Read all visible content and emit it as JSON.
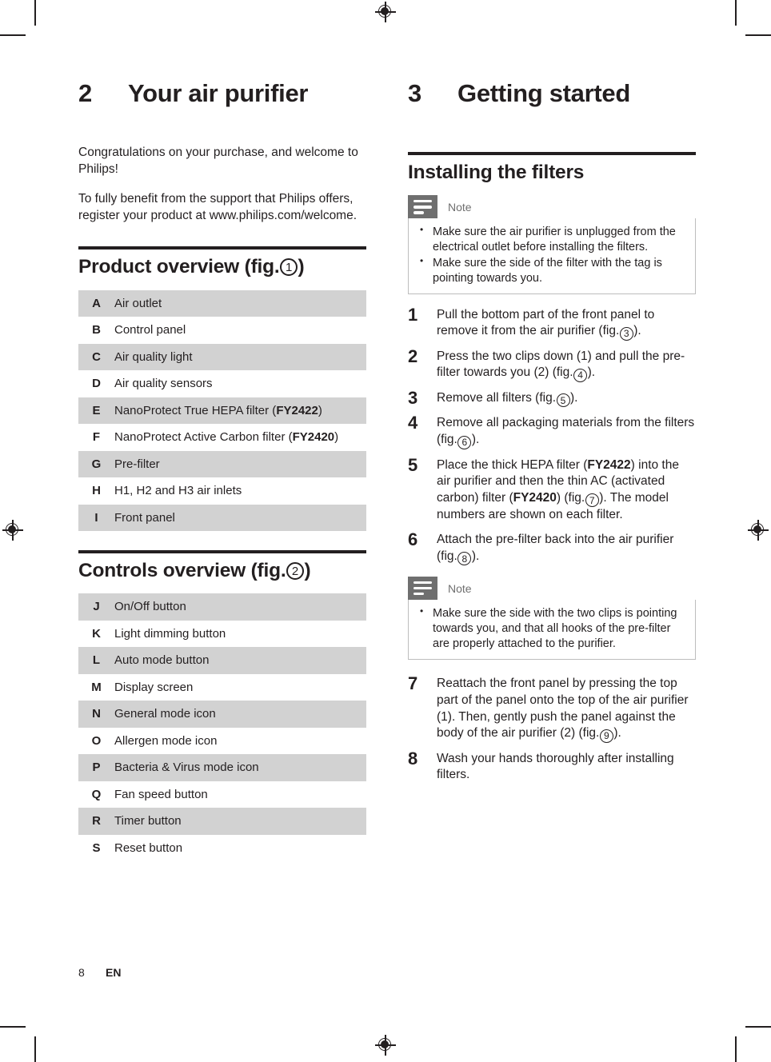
{
  "page": {
    "number": "8",
    "language": "EN"
  },
  "left_column": {
    "chapter": {
      "number": "2",
      "title": "Your air purifier"
    },
    "paragraphs": [
      "Congratulations on your purchase, and welcome to Philips!",
      "To fully benefit from the support that Philips offers, register your product at www.philips.com/welcome."
    ],
    "product_overview": {
      "heading_prefix": "Product overview (fig.",
      "heading_fig": "1",
      "heading_suffix": ")",
      "rows": [
        {
          "key": "A",
          "label": "Air outlet",
          "shaded": true
        },
        {
          "key": "B",
          "label": "Control panel",
          "shaded": false
        },
        {
          "key": "C",
          "label": "Air quality light",
          "shaded": true
        },
        {
          "key": "D",
          "label": "Air quality sensors",
          "shaded": false
        },
        {
          "key": "E",
          "label": "NanoProtect True HEPA filter (FY2422)",
          "label_plain": "NanoProtect True HEPA filter (",
          "label_bold": "FY2422",
          "label_tail": ")",
          "shaded": true
        },
        {
          "key": "F",
          "label": "NanoProtect Active Carbon filter (FY2420)",
          "label_plain": "NanoProtect Active Carbon filter (",
          "label_bold": "FY2420",
          "label_tail": ")",
          "shaded": false
        },
        {
          "key": "G",
          "label": "Pre-filter",
          "shaded": true
        },
        {
          "key": "H",
          "label": "H1, H2 and H3 air inlets",
          "shaded": false
        },
        {
          "key": "I",
          "label": "Front panel",
          "shaded": true
        }
      ]
    },
    "controls_overview": {
      "heading_prefix": "Controls overview (fig.",
      "heading_fig": "2",
      "heading_suffix": ")",
      "rows": [
        {
          "key": "J",
          "label": "On/Off button",
          "shaded": true
        },
        {
          "key": "K",
          "label": "Light dimming button",
          "shaded": false
        },
        {
          "key": "L",
          "label": "Auto mode button",
          "shaded": true
        },
        {
          "key": "M",
          "label": "Display screen",
          "shaded": false
        },
        {
          "key": "N",
          "label": "General mode icon",
          "shaded": true
        },
        {
          "key": "O",
          "label": "Allergen mode icon",
          "shaded": false
        },
        {
          "key": "P",
          "label": "Bacteria & Virus mode icon",
          "shaded": true
        },
        {
          "key": "Q",
          "label": "Fan speed button",
          "shaded": false
        },
        {
          "key": "R",
          "label": "Timer button",
          "shaded": true
        },
        {
          "key": "S",
          "label": "Reset button",
          "shaded": false
        }
      ]
    }
  },
  "right_column": {
    "chapter": {
      "number": "3",
      "title": "Getting started"
    },
    "section_heading": "Installing the filters",
    "note_top": {
      "label": "Note",
      "items": [
        "Make sure the air purifier is unplugged from the electrical outlet before installing the filters.",
        "Make sure the side of the filter with the tag is pointing towards you."
      ]
    },
    "steps_first": [
      {
        "number": "1",
        "parts": [
          {
            "t": "text",
            "v": "Pull the bottom part of the front panel to remove it from the air purifier (fig."
          },
          {
            "t": "circle",
            "v": "3"
          },
          {
            "t": "text",
            "v": ")."
          }
        ]
      },
      {
        "number": "2",
        "parts": [
          {
            "t": "text",
            "v": "Press the two clips down (1) and pull the pre-filter towards you (2) (fig."
          },
          {
            "t": "circle",
            "v": "4"
          },
          {
            "t": "text",
            "v": ")."
          }
        ]
      },
      {
        "number": "3",
        "parts": [
          {
            "t": "text",
            "v": "Remove all filters (fig."
          },
          {
            "t": "circle",
            "v": "5"
          },
          {
            "t": "text",
            "v": ")."
          }
        ]
      },
      {
        "number": "4",
        "parts": [
          {
            "t": "text",
            "v": "Remove all packaging materials from the filters (fig."
          },
          {
            "t": "circle",
            "v": "6"
          },
          {
            "t": "text",
            "v": ")."
          }
        ]
      },
      {
        "number": "5",
        "parts": [
          {
            "t": "text",
            "v": "Place the thick HEPA filter ("
          },
          {
            "t": "bold",
            "v": "FY2422"
          },
          {
            "t": "text",
            "v": ") into the air purifier and then the thin AC (activated carbon) filter ("
          },
          {
            "t": "bold",
            "v": "FY2420"
          },
          {
            "t": "text",
            "v": ") (fig."
          },
          {
            "t": "circle",
            "v": "7"
          },
          {
            "t": "text",
            "v": "). The model numbers are shown on each filter."
          }
        ]
      },
      {
        "number": "6",
        "parts": [
          {
            "t": "text",
            "v": "Attach the pre-filter back into the air purifier (fig."
          },
          {
            "t": "circle",
            "v": "8"
          },
          {
            "t": "text",
            "v": ")."
          }
        ]
      }
    ],
    "note_bottom": {
      "label": "Note",
      "items": [
        "Make sure the side with the two clips is pointing towards you, and that all hooks of the pre-filter are properly attached to the purifier."
      ]
    },
    "steps_second": [
      {
        "number": "7",
        "parts": [
          {
            "t": "text",
            "v": "Reattach the front panel by pressing the top part of the panel onto the top of the air purifier (1). Then, gently push the panel against the body of the air purifier (2) (fig."
          },
          {
            "t": "circle",
            "v": "9"
          },
          {
            "t": "text",
            "v": ")."
          }
        ]
      },
      {
        "number": "8",
        "parts": [
          {
            "t": "text",
            "v": "Wash your hands thoroughly after installing filters."
          }
        ]
      }
    ]
  },
  "colors": {
    "text": "#231f20",
    "table_shade": "#d2d2d2",
    "note_icon_bg": "#6f6f6f",
    "note_border": "#bdbdbd"
  }
}
